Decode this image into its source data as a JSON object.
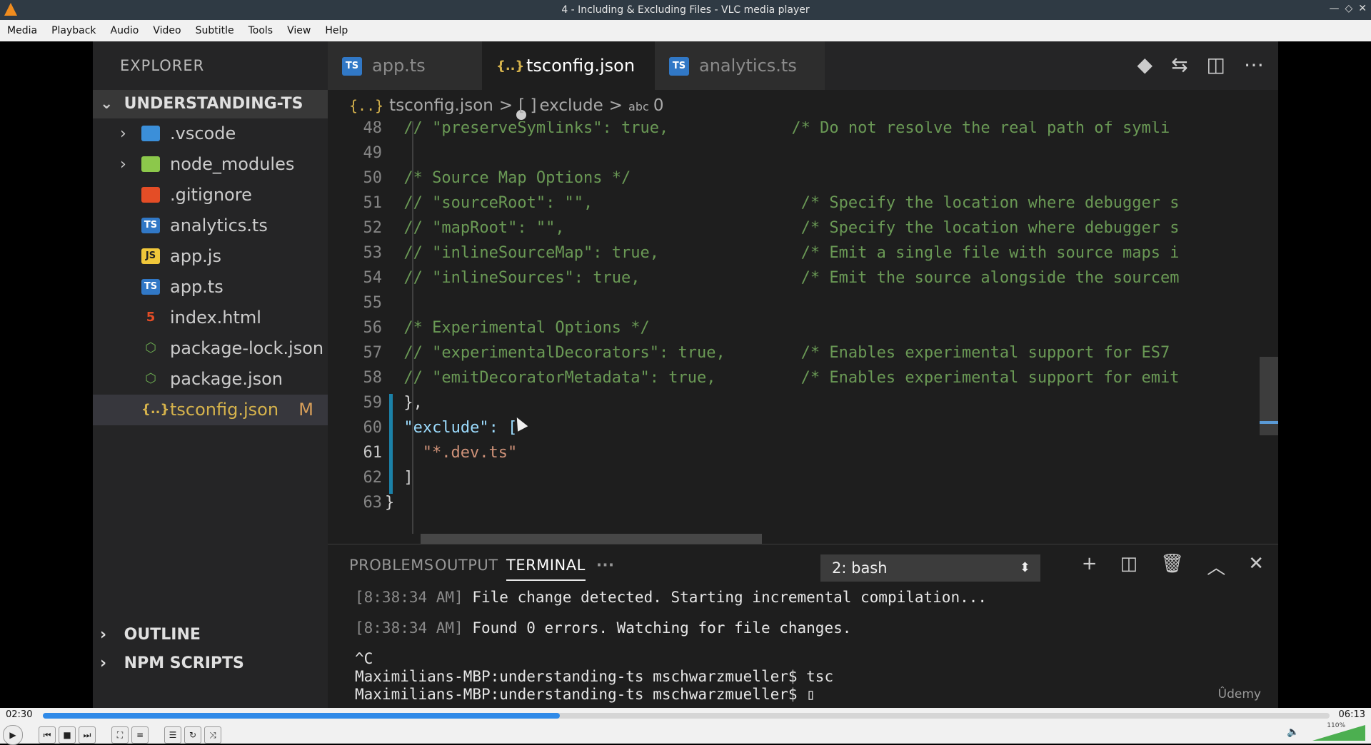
{
  "window": {
    "title": "4 - Including & Excluding Files - VLC media player",
    "controls": [
      "—",
      "◇",
      "✕"
    ]
  },
  "menu": [
    "Media",
    "Playback",
    "Audio",
    "Video",
    "Subtitle",
    "Tools",
    "View",
    "Help"
  ],
  "sidebar": {
    "header": "EXPLORER",
    "project": "UNDERSTANDING-TS",
    "items": [
      {
        "label": ".vscode",
        "icon": "folder-vscode-icon",
        "chevron": "›",
        "color": "#3b8fd9",
        "badge": ""
      },
      {
        "label": "node_modules",
        "icon": "folder-node-icon",
        "chevron": "›",
        "color": "#8cc84b",
        "badge": ""
      },
      {
        "label": ".gitignore",
        "icon": "git-icon",
        "chevron": "",
        "color": "#e44d26",
        "badge": ""
      },
      {
        "label": "analytics.ts",
        "icon": "typescript-icon",
        "chevron": "",
        "color": "#3178c6",
        "badge": "TS"
      },
      {
        "label": "app.js",
        "icon": "javascript-icon",
        "chevron": "",
        "color": "#f0c73a",
        "badge": "JS"
      },
      {
        "label": "app.ts",
        "icon": "typescript-icon",
        "chevron": "",
        "color": "#3178c6",
        "badge": "TS"
      },
      {
        "label": "index.html",
        "icon": "html5-icon",
        "chevron": "",
        "color": "#e44d26",
        "badge": "5"
      },
      {
        "label": "package-lock.json",
        "icon": "npm-icon",
        "chevron": "",
        "color": "#6aa84f",
        "badge": "⬡"
      },
      {
        "label": "package.json",
        "icon": "npm-icon",
        "chevron": "",
        "color": "#6aa84f",
        "badge": "⬡"
      },
      {
        "label": "tsconfig.json",
        "icon": "json-icon",
        "chevron": "",
        "color": "#d6b34c",
        "badge": "{..}",
        "status": "M",
        "active": true
      }
    ],
    "outline": "OUTLINE",
    "npm_scripts": "NPM SCRIPTS"
  },
  "tabs": [
    {
      "label": "app.ts",
      "icon": "TS",
      "color": "#3178c6"
    },
    {
      "label": "tsconfig.json",
      "icon": "{..}",
      "color": "#d6b34c",
      "active": true,
      "modified": true
    },
    {
      "label": "analytics.ts",
      "icon": "TS",
      "color": "#3178c6"
    }
  ],
  "tab_actions": [
    "◆",
    "⇆",
    "◫",
    "⋯"
  ],
  "breadcrumb": {
    "icon": "{..}",
    "file": "tsconfig.json",
    "sep": ">",
    "array_icon": "[ ]",
    "key": "exclude",
    "abc_icon": "abc",
    "index": "0"
  },
  "code_lines": [
    {
      "n": "48",
      "t": "// \"preserveSymlinks\": true,             /* Do not resolve the real path of symli",
      "k": "com"
    },
    {
      "n": "49",
      "t": "",
      "k": "com"
    },
    {
      "n": "50",
      "t": "/* Source Map Options */",
      "k": "com"
    },
    {
      "n": "51",
      "t": "// \"sourceRoot\": \"\",                      /* Specify the location where debugger s",
      "k": "com"
    },
    {
      "n": "52",
      "t": "// \"mapRoot\": \"\",                         /* Specify the location where debugger s",
      "k": "com"
    },
    {
      "n": "53",
      "t": "// \"inlineSourceMap\": true,               /* Emit a single file with source maps i",
      "k": "com"
    },
    {
      "n": "54",
      "t": "// \"inlineSources\": true,                 /* Emit the source alongside the sourcem",
      "k": "com"
    },
    {
      "n": "55",
      "t": "",
      "k": "com"
    },
    {
      "n": "56",
      "t": "/* Experimental Options */",
      "k": "com"
    },
    {
      "n": "57",
      "t": "// \"experimentalDecorators\": true,        /* Enables experimental support for ES7",
      "k": "com"
    },
    {
      "n": "58",
      "t": "// \"emitDecoratorMetadata\": true,         /* Enables experimental support for emit",
      "k": "com"
    },
    {
      "n": "59",
      "t": "},",
      "k": "pun",
      "indent": "  "
    },
    {
      "n": "60",
      "t": "\"exclude\": [",
      "k": "key",
      "indent": "  "
    },
    {
      "n": "61",
      "t": "\"*.dev.ts\"",
      "k": "str",
      "indent": "    ",
      "current": true
    },
    {
      "n": "62",
      "t": "]",
      "k": "pun",
      "indent": "  "
    },
    {
      "n": "63",
      "t": "}",
      "k": "pun",
      "indent": ""
    }
  ],
  "panel": {
    "tabs": [
      "PROBLEMS",
      "OUTPUT",
      "TERMINAL",
      "···"
    ],
    "active_tab": "TERMINAL",
    "terminal_select": "2: bash",
    "actions": [
      "+",
      "◫",
      "🗑",
      "︿",
      "✕"
    ],
    "terminal_lines": [
      {
        "ts": "[8:38:34 AM]",
        "text": " File change detected. Starting incremental compilation..."
      },
      {
        "ts": "",
        "text": ""
      },
      {
        "ts": "[8:38:34 AM]",
        "text": " Found 0 errors. Watching for file changes."
      },
      {
        "ts": "",
        "text": ""
      },
      {
        "ts": "",
        "text": "^C"
      },
      {
        "ts": "",
        "text": "Maximilians-MBP:understanding-ts mschwarzmueller$ tsc"
      },
      {
        "ts": "",
        "text": "Maximilians-MBP:understanding-ts mschwarzmueller$ ▯"
      }
    ],
    "watermark": "Ûdemy"
  },
  "player": {
    "elapsed": "02:30",
    "total": "06:13",
    "progress": 0.402,
    "volume_label": "110%",
    "accent": "#2f8ae8"
  }
}
